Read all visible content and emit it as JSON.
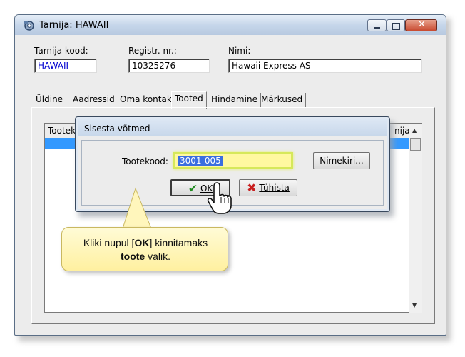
{
  "window": {
    "title": "Tarnija: HAWAII"
  },
  "fields": [
    {
      "label": "Tarnija kood:",
      "value": "HAWAII"
    },
    {
      "label": "Registr. nr.:",
      "value": "10325276"
    },
    {
      "label": "Nimi:",
      "value": "Hawaii Express AS"
    }
  ],
  "tabs": [
    "Üldine",
    "Aadressid",
    "Oma kontakt",
    "Tooted",
    "Hindamine",
    "Märkused"
  ],
  "active_tab": "Tooted",
  "grid": {
    "col1": "Tootek",
    "col2": "nija"
  },
  "dialog": {
    "title": "Sisesta võtmed",
    "code_label": "Tootekood:",
    "code_value": "3001-005",
    "list_button": "Nimekiri...",
    "ok_button": "OK",
    "cancel_button": "Tühista"
  },
  "callout": {
    "pre": "Kliki nupul [",
    "bold1": "OK",
    "mid": "] kinnitamaks",
    "bold2": "toote",
    "post": " valik."
  },
  "icons": {
    "app": "settings-app-icon",
    "ok": "checkmark-icon",
    "cancel": "x-icon",
    "cursor": "hand-pointer-icon"
  }
}
